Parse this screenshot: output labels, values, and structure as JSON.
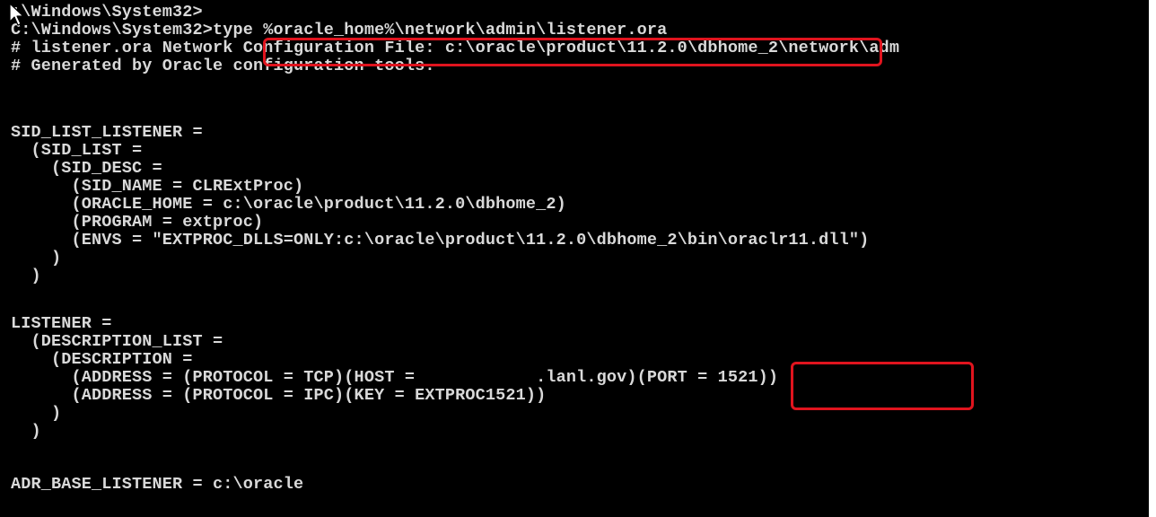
{
  "console": {
    "lines": [
      ":\\Windows\\System32>",
      "C:\\Windows\\System32>type %oracle_home%\\network\\admin\\listener.ora",
      "# listener.ora Network Configuration File: c:\\oracle\\product\\11.2.0\\dbhome_2\\network\\adm",
      "# Generated by Oracle configuration tools.",
      "",
      "SID_LIST_LISTENER =",
      "  (SID_LIST =",
      "    (SID_DESC =",
      "      (SID_NAME = CLRExtProc)",
      "      (ORACLE_HOME = c:\\oracle\\product\\11.2.0\\dbhome_2)",
      "      (PROGRAM = extproc)",
      "      (ENVS = \"EXTPROC_DLLS=ONLY:c:\\oracle\\product\\11.2.0\\dbhome_2\\bin\\oraclr11.dll\")",
      "    )",
      "  )",
      "",
      "LISTENER =",
      "  (DESCRIPTION_LIST =",
      "    (DESCRIPTION =",
      "      (ADDRESS = (PROTOCOL = TCP)(HOST =            .lanl.gov)(PORT = 1521))",
      "      (ADDRESS = (PROTOCOL = IPC)(KEY = EXTPROC1521))",
      "    )",
      "  )",
      "",
      "ADR_BASE_LISTENER = c:\\oracle"
    ]
  },
  "colors": {
    "background": "#000000",
    "text": "#d9d9d9",
    "highlight": "#e0141e"
  },
  "icons": {
    "cursor": "mouse-pointer-icon"
  }
}
